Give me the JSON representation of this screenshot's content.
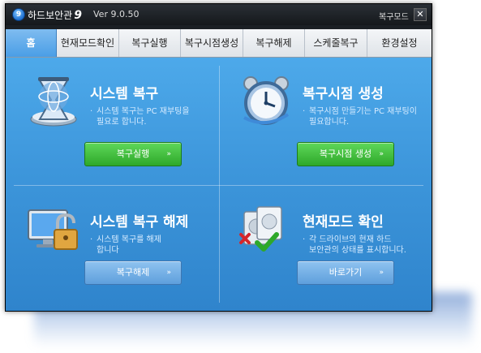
{
  "window": {
    "logo_glyph": "9",
    "app_name": "하드보안관",
    "app_version_mark": "9",
    "version": "Ver 9.0.50",
    "restore_mode": "복구모드",
    "close_glyph": "✕"
  },
  "tabs": [
    {
      "label": "홈",
      "active": true
    },
    {
      "label": "현재모드확인",
      "active": false
    },
    {
      "label": "복구실행",
      "active": false
    },
    {
      "label": "복구시점생성",
      "active": false
    },
    {
      "label": "복구해제",
      "active": false
    },
    {
      "label": "스케줄복구",
      "active": false
    },
    {
      "label": "환경설정",
      "active": false
    }
  ],
  "panels": {
    "system_restore": {
      "icon": "restore-hourglass-icon",
      "title": "시스템 복구",
      "desc": "시스템 복구는 PC 재부팅을\n필요로 합니다.",
      "button": "복구실행",
      "arrow": "»"
    },
    "create_restore_point": {
      "icon": "alarm-clock-icon",
      "title": "복구시점 생성",
      "desc": "복구시점 만들기는 PC 재부팅이\n필요합니다.",
      "button": "복구시점 생성",
      "arrow": "»"
    },
    "release_restore": {
      "icon": "monitor-padlock-icon",
      "title": "시스템 복구 해제",
      "desc": "시스템 복구를 해제\n합니다",
      "button": "복구해제",
      "arrow": "»"
    },
    "check_mode": {
      "icon": "drives-check-icon",
      "title": "현재모드 확인",
      "desc": "각 드라이브의 현재 하드\n보안관의 상태를 표시합니다.",
      "button": "바로가기",
      "arrow": "»"
    }
  },
  "colors": {
    "content_bg": "#3d96db",
    "active_tab": "#4a9ee6",
    "green_button": "#2ea82a",
    "blue_button": "#5e9fdc"
  }
}
